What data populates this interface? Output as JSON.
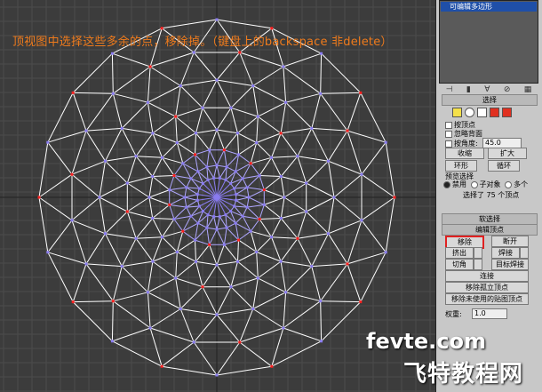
{
  "annotation": "顶视图中选择这些多余的点，移除掉。（键盘上的backspace 非delete）",
  "modifier_stack": {
    "selected_item": "可编辑多边形"
  },
  "selection": {
    "header": "选择",
    "by_vertex_label": "按顶点",
    "ignore_backface_label": "忽略背面",
    "by_angle_label": "按角度:",
    "angle_value": "45.0",
    "shrink_label": "收缩",
    "grow_label": "扩大",
    "ring_label": "环形",
    "loop_label": "循环",
    "preview_label": "预览选择",
    "preview_off": "禁用",
    "preview_subobj": "子对象",
    "preview_multi": "多个",
    "status": "选择了 75 个顶点"
  },
  "soft_selection": {
    "header": "软选择"
  },
  "edit_vertices": {
    "header": "编辑顶点",
    "remove_label": "移除",
    "break_label": "断开",
    "extrude_label": "挤出",
    "weld_label": "焊接",
    "chamfer_label": "切角",
    "target_weld_label": "目标焊接",
    "connect_label": "连接",
    "remove_isolated_label": "移除孤立顶点",
    "remove_unused_map_label": "移除未使用的贴图顶点",
    "weight_label": "权重:",
    "weight_value": "1.0"
  },
  "watermark": {
    "url": "fevte.com",
    "logo": "飞特教程网"
  },
  "colors": {
    "viewport_bg": "#3c3c3c",
    "grid": "#4c4c4c",
    "wire": "#ffffff",
    "vertex_default": "#8a7cf0",
    "vertex_selected": "#ff2020",
    "annotation": "#f07b1c",
    "remove_highlight": "#e02020"
  }
}
